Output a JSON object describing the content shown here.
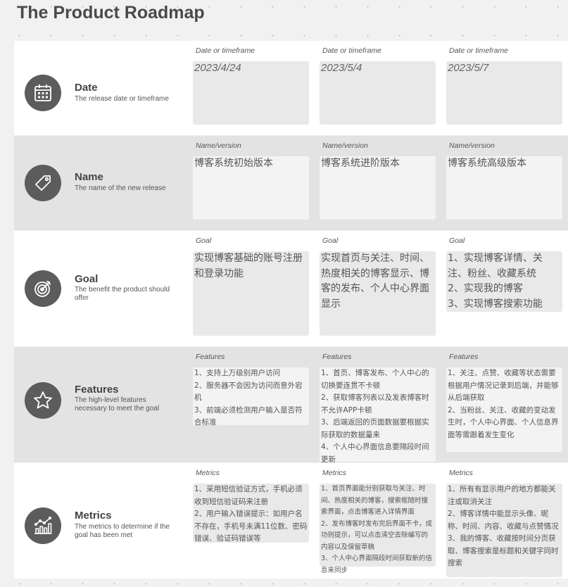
{
  "page": {
    "title": "The Product Roadmap"
  },
  "rows": {
    "date": {
      "title": "Date",
      "description": "The release date or timeframe",
      "icon": "calendar-icon",
      "column_label": "Date or timeframe",
      "values": [
        "2023/4/24",
        "2023/5/4",
        "2023/5/7"
      ]
    },
    "name": {
      "title": "Name",
      "description": "The name of the new release",
      "icon": "tag-icon",
      "column_label": "Name/version",
      "values": [
        "博客系统初始版本",
        "博客系统进阶版本",
        "博客系统高级版本"
      ]
    },
    "goal": {
      "title": "Goal",
      "description": "The benefit the product should offer",
      "icon": "target-icon",
      "column_label": "Goal",
      "values": [
        "实现博客基础的账号注册和登录功能",
        "实现首页与关注、时间、热度相关的博客显示、博客的发布、个人中心界面显示",
        "1、实现博客详情、关注、粉丝、收藏系统\n2、实现我的博客\n3、实现博客搜索功能"
      ]
    },
    "features": {
      "title": "Features",
      "description": "The high-level features necessary to meet the goal",
      "icon": "star-icon",
      "column_label": "Features",
      "values": [
        "1、支持上万级别用户访问\n2、服务器不会因为访问而意外宕机\n3、前端必须检测用户输入是否符合标准",
        "1、首页、博客发布、个人中心的切换要连贯不卡顿\n2、获取博客列表以及发表博客时不允许APP卡顿\n3、后端返回的页面数据要根据实际获取的数据量来\n4、个人中心界面信息要隔段时间更新",
        "1、关注、点赞、收藏等状态需要根据用户情况记录到后端，并能够从后端获取\n2、当粉丝、关注、收藏的变动发生时，个人中心界面、个人信息界面等需跟着发生变化"
      ]
    },
    "metrics": {
      "title": "Metrics",
      "description": "The metrics to determine if the goal has been met",
      "icon": "chart-icon",
      "column_label": "Metrics",
      "values": [
        "1、采用短信验证方式，手机必须收到短信验证码来注册\n2、用户输入错误提示：如用户名不存在，手机号未满11位数、密码错误、验证码错误等",
        "1、首页界面能分别获取与关注、时间、热度相关的博客，搜索框随时搜索界面，点击博客进入详情界面\n2、发布博客时发布完后界面不卡，成功则提示，可以点击清空去除编写的内容以及保留草稿\n3、个人中心界面隔段时间获取新的信息来同步",
        "1、所有有显示用户的地方都能关注或取消关注\n2、博客详情中能显示头像、昵称、时间、内容、收藏与点赞情况\n3、我的博客、收藏按时间分页获取、博客搜索是标题和关键字同时搜索"
      ]
    }
  }
}
